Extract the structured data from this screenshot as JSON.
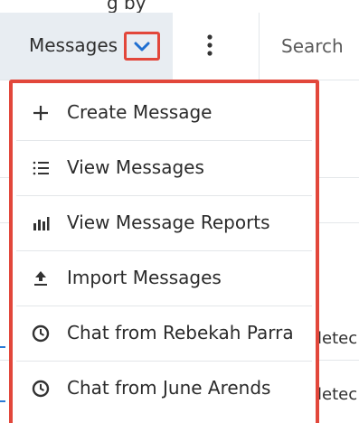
{
  "top_cut_text": "g by",
  "nav": {
    "module_label": "Messages",
    "search_placeholder": "Search"
  },
  "background": {
    "row_fragment_1": "letec",
    "row_fragment_2": "letec"
  },
  "menu": {
    "items": [
      {
        "label": "Create Message",
        "icon": "plus-icon"
      },
      {
        "label": "View Messages",
        "icon": "list-icon"
      },
      {
        "label": "View Message Reports",
        "icon": "bar-chart-icon"
      },
      {
        "label": "Import Messages",
        "icon": "upload-icon"
      },
      {
        "label": "Chat from Rebekah Parra",
        "icon": "clock-icon"
      },
      {
        "label": "Chat from June Arends",
        "icon": "clock-icon"
      }
    ]
  },
  "colors": {
    "highlight": "#e2473b",
    "tab_bg": "#e8edf2",
    "chevron": "#1f6fd1"
  }
}
